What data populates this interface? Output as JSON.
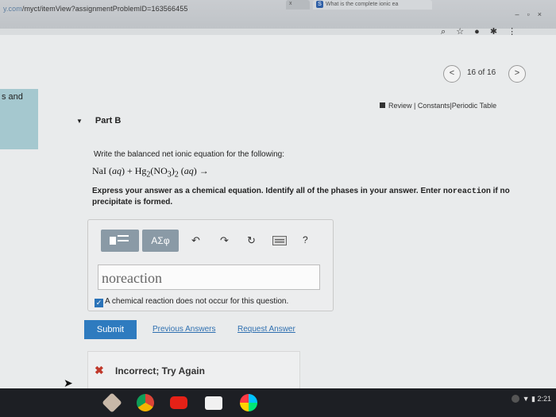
{
  "browser": {
    "url_prefix": "y.com",
    "url_path": "/myct/itemView?assignmentProblemID=163566455",
    "tabs": [
      {
        "label": "x"
      },
      {
        "label": "What is the complete ionic ea"
      }
    ],
    "toolbar_icons": [
      "search-icon",
      "star-icon",
      "profile-icon",
      "extensions-icon",
      "menu-icon"
    ]
  },
  "nav": {
    "prev": "<",
    "next": ">",
    "position": "16 of 16"
  },
  "side_tab": {
    "label": "s and"
  },
  "review_bar": {
    "review": "Review",
    "sep1": "|",
    "constants": "Constants",
    "sep2": "|",
    "periodic": "Periodic Table"
  },
  "part": {
    "label": "Part B"
  },
  "question": {
    "prompt": "Write the balanced net ionic equation for the following:",
    "equation_html": "NaI (<i>aq</i>) + Hg<sub>2</sub>(NO<sub>3</sub>)<sub>2</sub> (<i>aq</i>) &rarr;",
    "instructions_main": "Express your answer as a chemical equation. Identify all of the phases in your answer. Enter ",
    "instructions_code": "noreaction",
    "instructions_tail": " if no precipitate is formed."
  },
  "toolbar": {
    "greek_label": "ΑΣφ",
    "help_label": "?"
  },
  "answer": {
    "value": "noreaction",
    "checkbox_label": "A chemical reaction does not occur for this question.",
    "checked": true
  },
  "actions": {
    "submit": "Submit",
    "previous_answers": "Previous Answers",
    "request_answer": "Request Answer"
  },
  "feedback": {
    "icon": "✖",
    "message": "Incorrect; Try Again"
  },
  "taskbar": {
    "time": "2:21",
    "apps": [
      "app-launcher-icon",
      "chrome-icon",
      "youtube-icon",
      "gmail-icon",
      "play-store-icon"
    ]
  }
}
